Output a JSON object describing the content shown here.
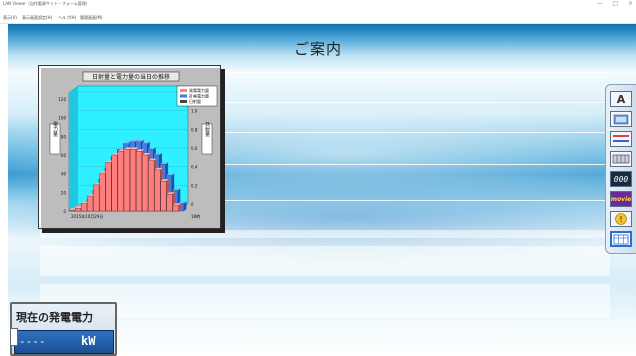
{
  "window": {
    "title": "LAN Viewer（自作電源サイト・フォーム管理）",
    "controls": [
      "—",
      "□",
      "×"
    ]
  },
  "menubar": {
    "items": [
      "表示(V)",
      "表示画面設定(H)",
      "ヘルプ(H)",
      "管理画面(M)"
    ]
  },
  "notice": {
    "title": "ご案内"
  },
  "chart_data": {
    "type": "bar",
    "title": "日射量と電力量の当日の推移",
    "legend_position": "top-right",
    "legend": [
      "発電電力量",
      "計画電力量",
      "日射量"
    ],
    "colors": {
      "series_a": "#ff7f7f",
      "series_b": "#3f7fe0",
      "plot_bg": "#2ef0ff",
      "panel_bg": "#bdbdbd"
    },
    "x_date_label": "2015年10月29日",
    "x_end_label": "18時",
    "y_left_ticks": [
      "120",
      "100",
      "80",
      "60",
      "40",
      "20",
      "0"
    ],
    "y_right_ticks": [
      "1.2",
      "1.0",
      "0.8",
      "0.6",
      "0.4",
      "0.2",
      "0"
    ],
    "ylabel_left": "電力量",
    "ylabel_right": "日射量",
    "ylim": [
      0,
      120
    ],
    "series": [
      {
        "name": "発電電力量",
        "values": [
          1,
          3,
          8,
          16,
          28,
          40,
          52,
          60,
          64,
          66,
          66,
          64,
          60,
          54,
          44,
          32,
          18,
          6
        ]
      },
      {
        "name": "計画電力量",
        "values": [
          2,
          5,
          12,
          22,
          34,
          46,
          58,
          66,
          72,
          74,
          74,
          72,
          66,
          60,
          50,
          38,
          22,
          8
        ]
      }
    ]
  },
  "toolbox": {
    "tools": [
      {
        "icon": "text-tool-icon",
        "label": "A"
      },
      {
        "icon": "image-tool-icon",
        "label": ""
      },
      {
        "icon": "line-tool-icon",
        "label": ""
      },
      {
        "icon": "scale-tool-icon",
        "label": ""
      },
      {
        "icon": "digital-counter-icon",
        "label": "000"
      },
      {
        "icon": "movie-tool-icon",
        "label": "movie"
      },
      {
        "icon": "alert-tool-icon",
        "label": "!"
      },
      {
        "icon": "table-tool-icon",
        "label": ""
      }
    ]
  },
  "power_panel": {
    "label": "現在の発電電力",
    "value": "----",
    "unit": "kW"
  }
}
